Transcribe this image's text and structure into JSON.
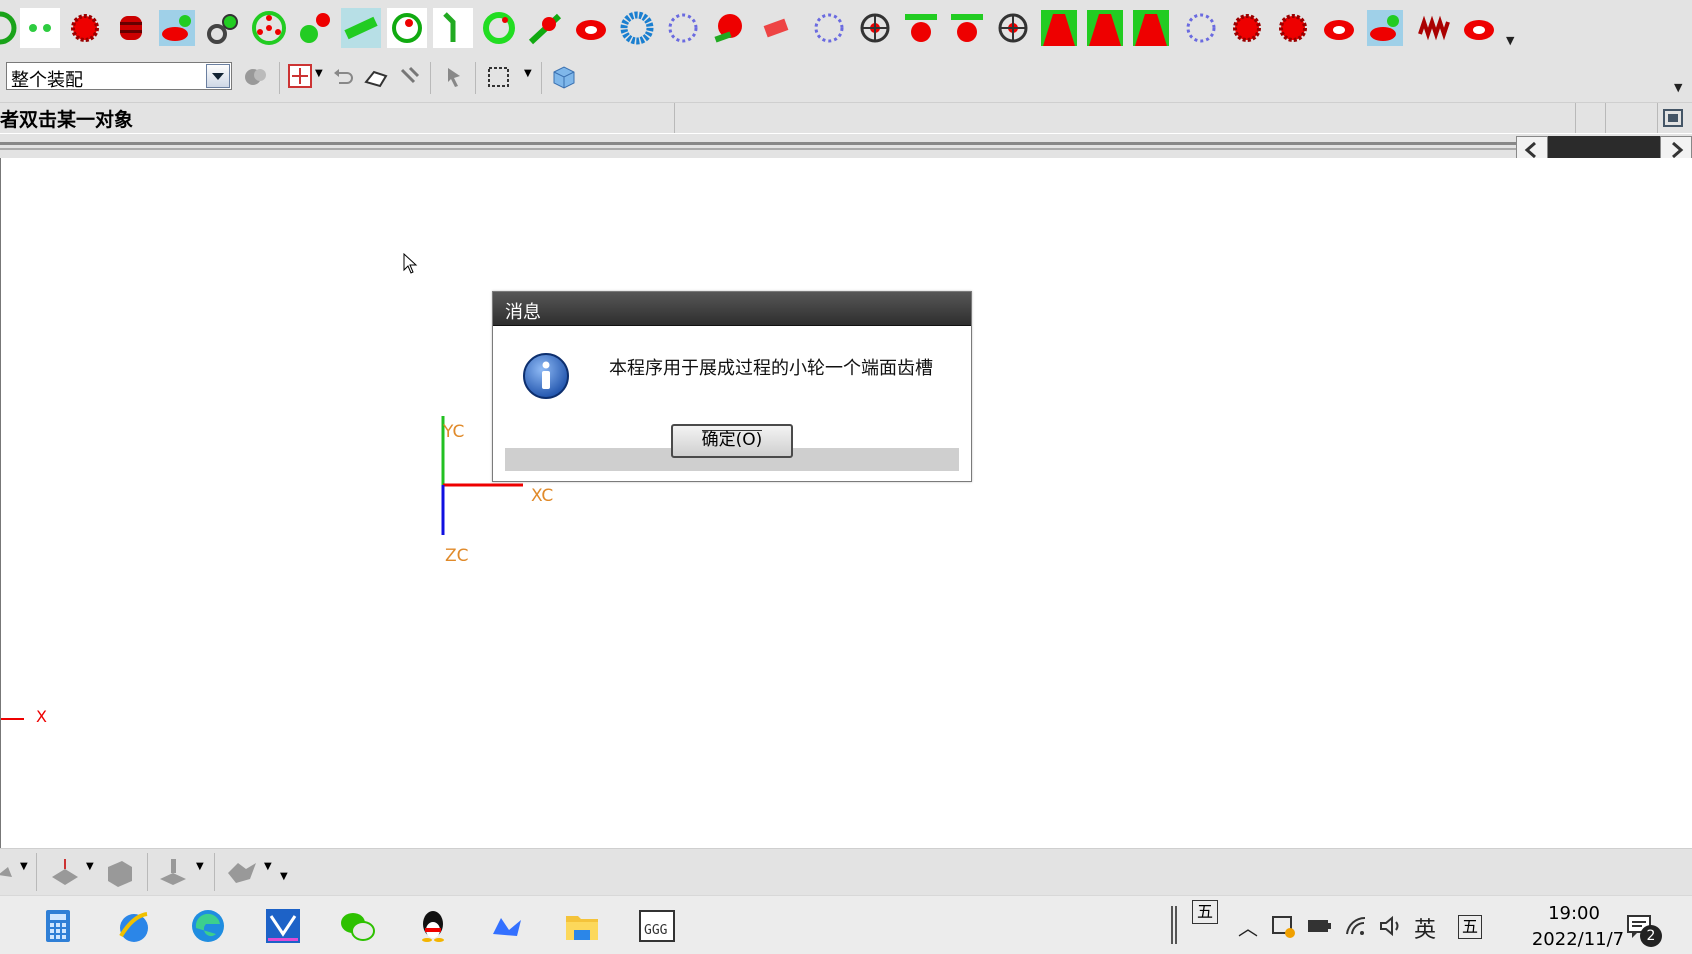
{
  "toolbar_top": {
    "icons": [
      "ring-gear-icon",
      "twin-dots-icon",
      "red-gear-icon",
      "cylinder-gear-icon",
      "bevel-gear-icon",
      "gear-pair-icon",
      "planet-gear-icon",
      "gear-train-icon",
      "shaft-icon",
      "ring-icon",
      "link-icon",
      "green-ring-icon",
      "rack-icon",
      "red-disk-icon",
      "blue-gear-icon",
      "outline-gear-icon",
      "red-worm-icon",
      "red-block-icon",
      "outline-gear-2-icon",
      "spoked-wheel-icon",
      "t-gear-icon",
      "t-gear-2-icon",
      "spoked-wheel-2-icon",
      "tooth-profile-icon",
      "tooth-profile-2-icon",
      "tooth-profile-3-icon",
      "outline-gear-3-icon",
      "red-gear-2-icon",
      "red-gear-3-icon",
      "red-disk-2-icon",
      "bevel-gear-2-icon",
      "spring-icon",
      "red-disk-3-icon"
    ]
  },
  "toolbar_second": {
    "filter_value": "整个装配",
    "icons": [
      "assembly-nav-icon",
      "snap-point-icon",
      "undo-icon",
      "eraser-icon",
      "pick-icon",
      "pointer-tool-icon",
      "rect-select-icon",
      "cube-view-icon"
    ]
  },
  "status": {
    "prompt": "者双击某一对象"
  },
  "axes": {
    "yc": "YC",
    "xc": "XC",
    "zc": "ZC",
    "x": "X"
  },
  "dialog": {
    "title": "消息",
    "message": "本程序用于展成过程的小轮一个端面齿槽",
    "ok_label": "确定(O)"
  },
  "taskbar": {
    "apps": [
      "calculator-icon",
      "browser-globe-icon",
      "edge-icon",
      "nx-app-icon",
      "wechat-icon",
      "qq-icon",
      "lark-icon",
      "file-explorer-icon",
      "ggg-app-icon"
    ],
    "ime_mode": "五",
    "ime_lang": "英",
    "ime_mode2": "五",
    "time": "19:00",
    "date": "2022/11/7",
    "notification_count": "2"
  }
}
